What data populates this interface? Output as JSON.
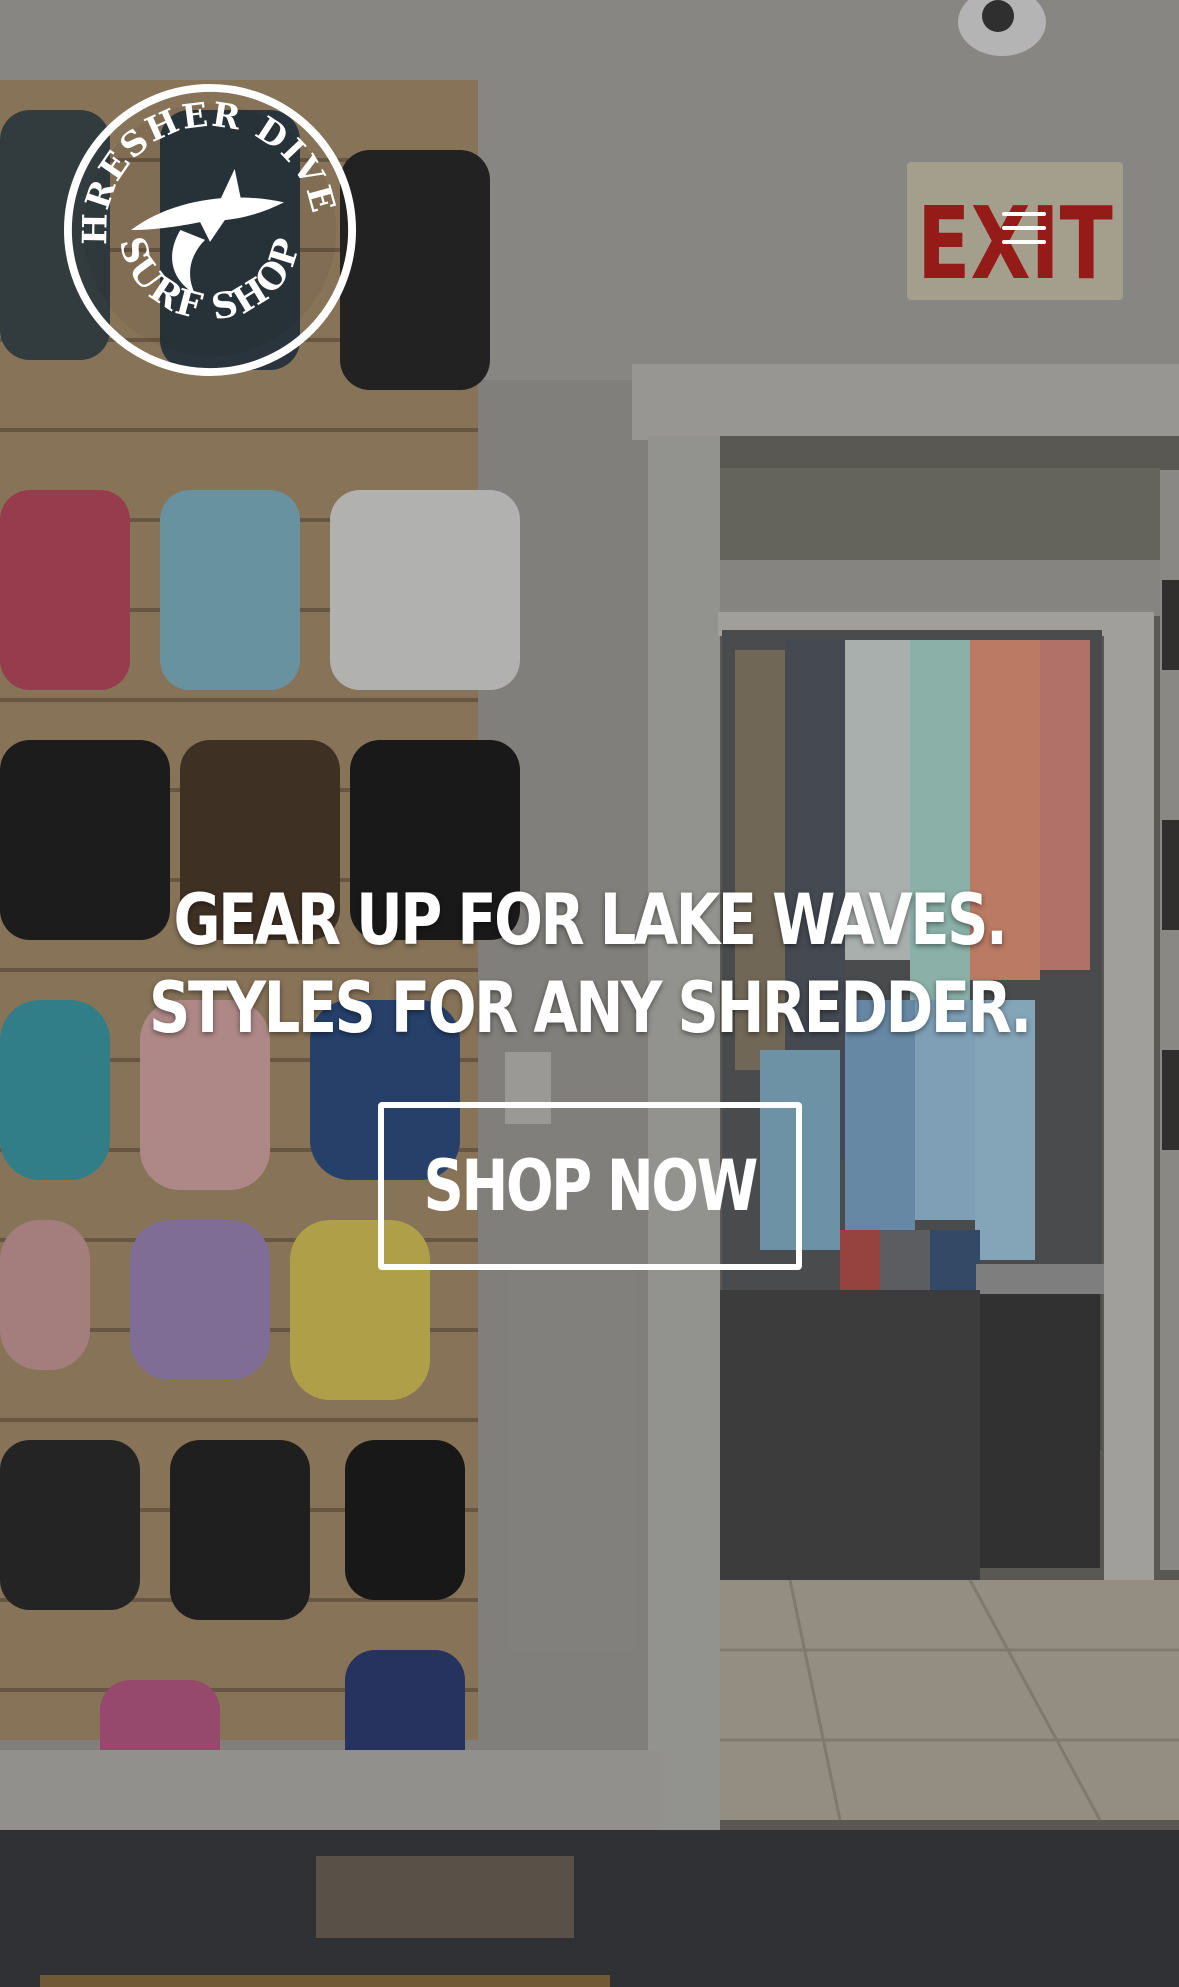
{
  "brand": {
    "name_top": "THRESHER DIVERS",
    "name_bottom": "SURF SHOP",
    "logo_color": "#ffffff"
  },
  "header": {
    "menu_icon": "hamburger-menu-icon"
  },
  "scene": {
    "exit_sign_text": "EXIT",
    "exit_sign_color": "#c8231f"
  },
  "hero": {
    "line1": "GEAR UP FOR LAKE WAVES.",
    "line2": "STYLES FOR ANY SHREDDER.",
    "cta_label": "SHOP NOW",
    "text_color": "#ffffff"
  }
}
